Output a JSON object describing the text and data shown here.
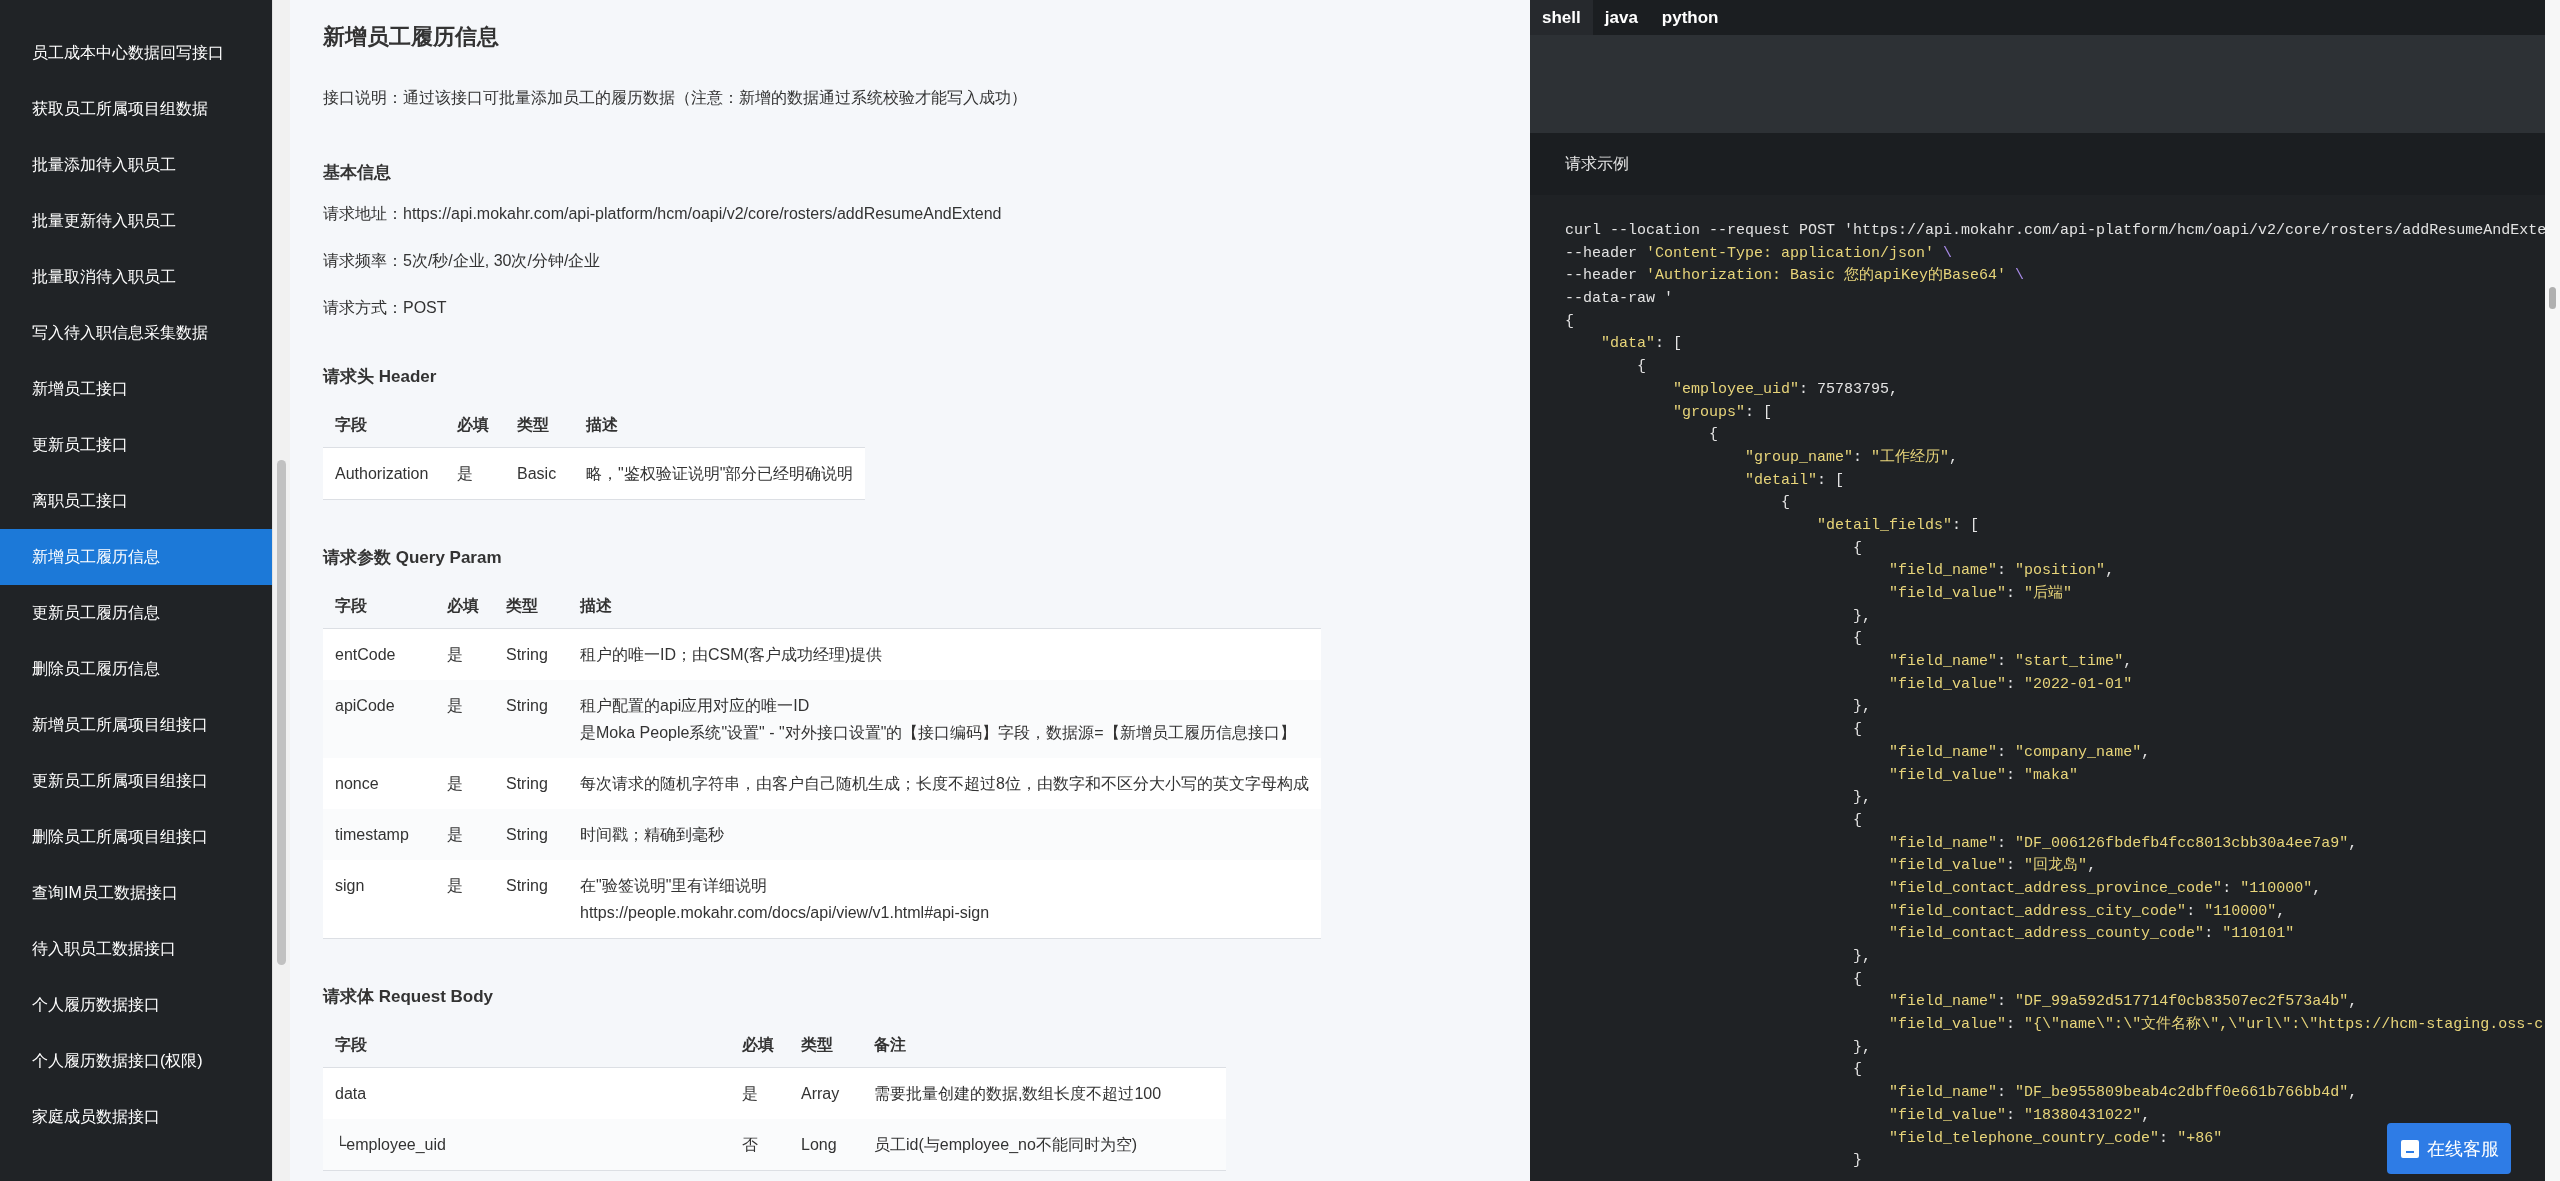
{
  "sidebar": {
    "items": [
      {
        "label": "员工成本中心数据回写接口",
        "selected": false
      },
      {
        "label": "获取员工所属项目组数据",
        "selected": false
      },
      {
        "label": "批量添加待入职员工",
        "selected": false
      },
      {
        "label": "批量更新待入职员工",
        "selected": false
      },
      {
        "label": "批量取消待入职员工",
        "selected": false
      },
      {
        "label": "写入待入职信息采集数据",
        "selected": false
      },
      {
        "label": "新增员工接口",
        "selected": false
      },
      {
        "label": "更新员工接口",
        "selected": false
      },
      {
        "label": "离职员工接口",
        "selected": false
      },
      {
        "label": "新增员工履历信息",
        "selected": true
      },
      {
        "label": "更新员工履历信息",
        "selected": false
      },
      {
        "label": "删除员工履历信息",
        "selected": false
      },
      {
        "label": "新增员工所属项目组接口",
        "selected": false
      },
      {
        "label": "更新员工所属项目组接口",
        "selected": false
      },
      {
        "label": "删除员工所属项目组接口",
        "selected": false
      },
      {
        "label": "查询IM员工数据接口",
        "selected": false
      },
      {
        "label": "待入职员工数据接口",
        "selected": false
      },
      {
        "label": "个人履历数据接口",
        "selected": false
      },
      {
        "label": "个人履历数据接口(权限)",
        "selected": false
      },
      {
        "label": "家庭成员数据接口",
        "selected": false
      }
    ]
  },
  "content": {
    "title": "新增员工履历信息",
    "description": "接口说明：通过该接口可批量添加员工的履历数据（注意：新增的数据通过系统校验才能写入成功）",
    "basic_info": {
      "heading": "基本信息",
      "lines": [
        "请求地址：https://api.mokahr.com/api-platform/hcm/oapi/v2/core/rosters/addResumeAndExtend",
        "请求频率：5次/秒/企业, 30次/分钟/企业",
        "请求方式：POST"
      ]
    },
    "tables": [
      {
        "heading": "请求头 Header",
        "columns": [
          "字段",
          "必填",
          "类型",
          "描述"
        ],
        "rows": [
          [
            "Authorization",
            "是",
            "Basic",
            "略，\"鉴权验证说明\"部分已经明确说明"
          ]
        ]
      },
      {
        "heading": "请求参数 Query Param",
        "columns": [
          "字段",
          "必填",
          "类型",
          "描述"
        ],
        "rows": [
          [
            "entCode",
            "是",
            "String",
            "租户的唯一ID；由CSM(客户成功经理)提供"
          ],
          [
            "apiCode",
            "是",
            "String",
            "租户配置的api应用对应的唯一ID\n是Moka People系统\"设置\" - \"对外接口设置\"的【接口编码】字段，数据源=【新增员工履历信息接口】"
          ],
          [
            "nonce",
            "是",
            "String",
            "每次请求的随机字符串，由客户自己随机生成；长度不超过8位，由数字和不区分大小写的英文字母构成"
          ],
          [
            "timestamp",
            "是",
            "String",
            "时间戳；精确到毫秒"
          ],
          [
            "sign",
            "是",
            "String",
            "在\"验签说明\"里有详细说明\nhttps://people.mokahr.com/docs/api/view/v1.html#api-sign"
          ]
        ]
      },
      {
        "heading": "请求体 Request Body",
        "columns": [
          "字段",
          "必填",
          "类型",
          "备注"
        ],
        "rows": [
          [
            "data",
            "是",
            "Array",
            "需要批量创建的数据,数组长度不超过100"
          ],
          [
            "└employee_uid",
            "否",
            "Long",
            "员工id(与employee_no不能同时为空)"
          ]
        ]
      }
    ]
  },
  "code_panel": {
    "tabs": [
      {
        "label": "shell",
        "selected": true
      },
      {
        "label": "java",
        "selected": false
      },
      {
        "label": "python",
        "selected": false
      }
    ],
    "heading": "请求示例",
    "lines": [
      "curl --location --request POST 'https://api.mokahr.com/api-platform/hcm/oapi/v2/core/rosters/addResumeAndExte",
      "--header 'Content-Type: application/json' \\",
      "--header 'Authorization: Basic 您的apiKey的Base64' \\",
      "--data-raw '",
      "{",
      "    \"data\": [",
      "        {",
      "            \"employee_uid\": 75783795,",
      "            \"groups\": [",
      "                {",
      "                    \"group_name\": \"工作经历\",",
      "                    \"detail\": [",
      "                        {",
      "                            \"detail_fields\": [",
      "                                {",
      "                                    \"field_name\": \"position\",",
      "                                    \"field_value\": \"后端\"",
      "                                },",
      "                                {",
      "                                    \"field_name\": \"start_time\",",
      "                                    \"field_value\": \"2022-01-01\"",
      "                                },",
      "                                {",
      "                                    \"field_name\": \"company_name\",",
      "                                    \"field_value\": \"maka\"",
      "                                },",
      "                                {",
      "                                    \"field_name\": \"DF_006126fbdefb4fcc8013cbb30a4ee7a9\",",
      "                                    \"field_value\": \"回龙岛\",",
      "                                    \"field_contact_address_province_code\": \"110000\",",
      "                                    \"field_contact_address_city_code\": \"110000\",",
      "                                    \"field_contact_address_county_code\": \"110101\"",
      "                                },",
      "                                {",
      "                                    \"field_name\": \"DF_99a592d517714f0cb83507ec2f573a4b\",",
      "                                    \"field_value\": \"{\\\"name\\\":\\\"文件名称\\\",\\\"url\\\":\\\"https://hcm-staging.oss-c",
      "                                },",
      "                                {",
      "                                    \"field_name\": \"DF_be955809beab4c2dbff0e661b766bb4d\",",
      "                                    \"field_value\": \"18380431022\",",
      "                                    \"field_telephone_country_code\": \"+86\"",
      "                                }"
    ]
  },
  "chat_button": {
    "label": "在线客服"
  }
}
